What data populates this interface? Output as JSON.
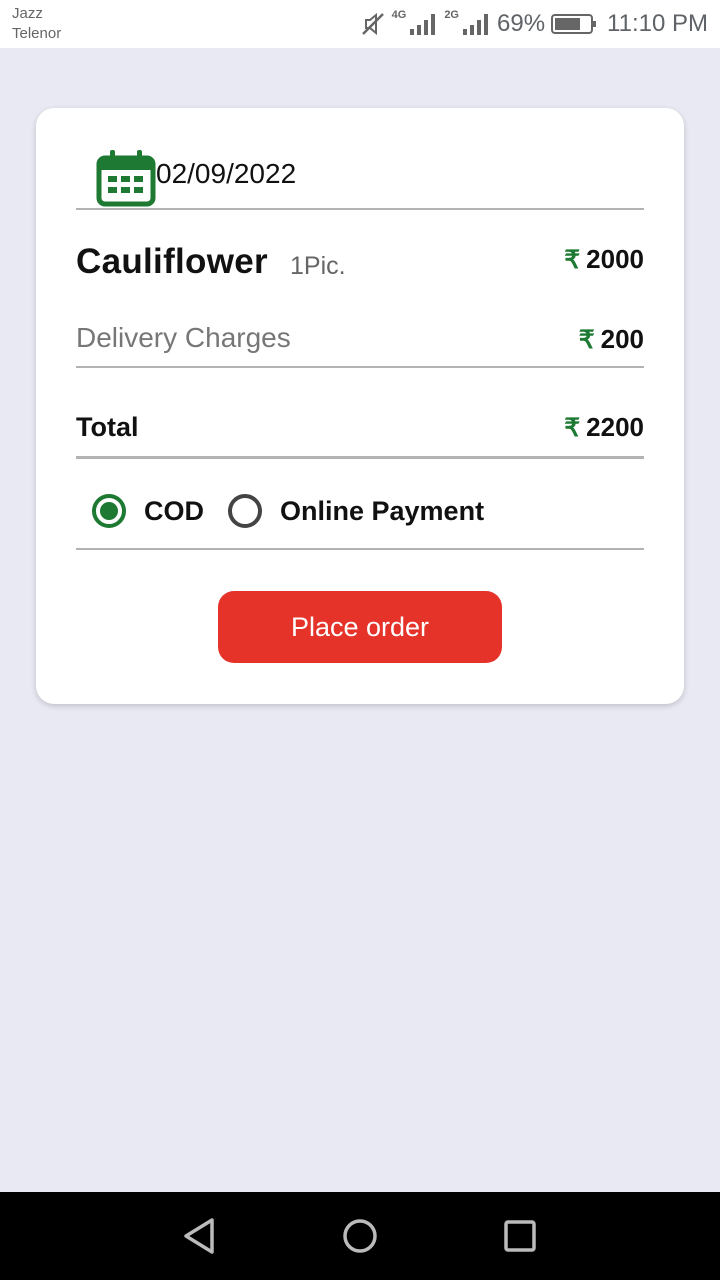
{
  "status_bar": {
    "carrier_1": "Jazz",
    "carrier_2": "Telenor",
    "network_1": "4G",
    "network_2": "2G",
    "battery": "69%",
    "time": "11:10 PM",
    "icons": [
      "mute-icon",
      "signal-icon",
      "signal-icon",
      "battery-icon"
    ]
  },
  "order": {
    "date": "02/09/2022",
    "product_name": "Cauliflower",
    "product_qty": "1Pic.",
    "product_price": "2000",
    "delivery_label": "Delivery Charges",
    "delivery_price": "200",
    "total_label": "Total",
    "total_price": "2200",
    "currency_symbol": "₹"
  },
  "payment": {
    "options": [
      {
        "label": "COD",
        "selected": true
      },
      {
        "label": "Online Payment",
        "selected": false
      }
    ]
  },
  "actions": {
    "place_order": "Place order"
  },
  "colors": {
    "accent_green": "#1e7a33",
    "button_red": "#e5332a",
    "background": "#e9e9f3"
  }
}
